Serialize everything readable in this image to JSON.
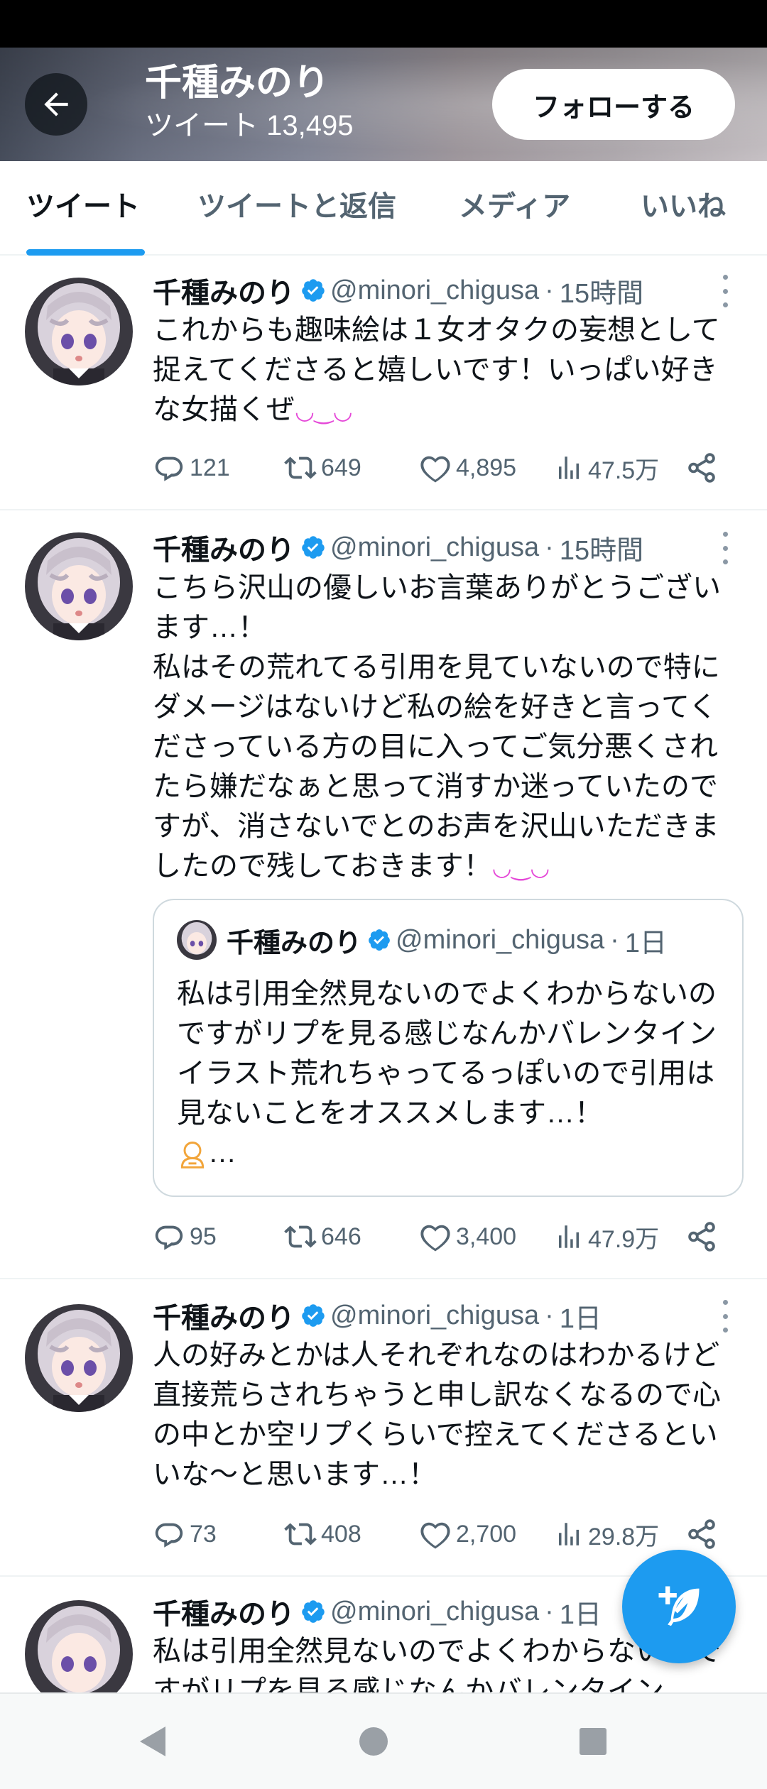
{
  "header": {
    "back_icon": "arrow-left-icon",
    "title": "千種みのり",
    "subtitle": "ツイート 13,495",
    "follow_label": "フォローする"
  },
  "tabs": [
    {
      "label": "ツイート",
      "active": true
    },
    {
      "label": "ツイートと返信",
      "active": false
    },
    {
      "label": "メディア",
      "active": false
    },
    {
      "label": "いいね",
      "active": false
    }
  ],
  "tweets": [
    {
      "name": "千種みのり",
      "handle": "@minori_chigusa",
      "time": "15時間",
      "text": "これからも趣味絵は１女オタクの妄想として捉えてくださると嬉しいです！いっぱい好きな女描くぜ",
      "replies": "121",
      "retweets": "649",
      "likes": "4,895",
      "views": "47.5万"
    },
    {
      "name": "千種みのり",
      "handle": "@minori_chigusa",
      "time": "15時間",
      "text": "こちら沢山の優しいお言葉ありがとうございます…！\n私はその荒れてる引用を見ていないので特にダメージはないけど私の絵を好きと言ってくださっている方の目に入ってご気分悪くされたら嫌だなぁと思って消すか迷っていたのですが、消さないでとのお声を沢山いただきましたので残しておきます！",
      "quote": {
        "name": "千種みのり",
        "handle": "@minori_chigusa",
        "time": "1日",
        "text": "私は引用全然見ないのでよくわからないのですがリプを見る感じなんかバレンタインイラスト荒れちゃってるっぽいので引用は見ないことをオススメします…！",
        "ellipsis": "…"
      },
      "replies": "95",
      "retweets": "646",
      "likes": "3,400",
      "views": "47.9万"
    },
    {
      "name": "千種みのり",
      "handle": "@minori_chigusa",
      "time": "1日",
      "text": "人の好みとかは人それぞれなのはわかるけど直接荒らされちゃうと申し訳なくなるので心の中とか空リプくらいで控えてくださるといいな〜と思います…！",
      "replies": "73",
      "retweets": "408",
      "likes": "2,700",
      "views": "29.8万"
    },
    {
      "name": "千種みのり",
      "handle": "@minori_chigusa",
      "time": "1日",
      "text": "私は引用全然見ないのでよくわからないのですがリプを見る感じなんかバレンタイン"
    }
  ],
  "colors": {
    "accent": "#1d9bf0",
    "text": "#0f1419",
    "muted": "#536471",
    "verified": "#1d9bf0"
  }
}
